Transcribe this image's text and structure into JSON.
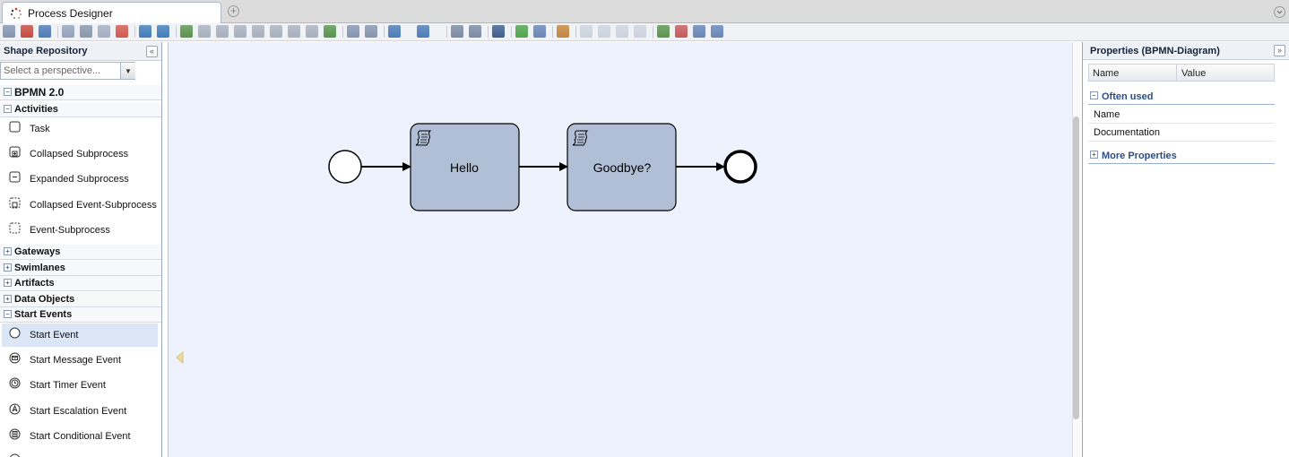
{
  "tab": {
    "title": "Process Designer"
  },
  "colors": {
    "accent": "#2b4d84",
    "task_fill": "#b0bfd6",
    "canvas_bg": "#eef2fc",
    "selected_item": "#dbe7f7"
  },
  "toolbar": {
    "icons": [
      "print-icon",
      "pdf-icon",
      "info-icon",
      "cut-icon",
      "copy-icon",
      "paste-icon",
      "delete-icon",
      "undo-icon",
      "redo-icon",
      "group-icon",
      "ungroup-icon",
      "align-left-icon",
      "align-center-icon",
      "align-right-icon",
      "align-top-icon",
      "align-middle-icon",
      "align-bottom-icon",
      "same-size-icon",
      "add-docker-icon",
      "remove-docker-icon",
      "import-icon",
      "export-icon",
      "zoom-in-icon",
      "zoom-out-icon",
      "save-icon",
      "validate-icon",
      "simulate-icon",
      "auto-layout-icon",
      "view-1-icon",
      "view-2-icon",
      "view-3-icon",
      "view-4-icon",
      "expand-icon",
      "collapse-icon",
      "fit-icon",
      "fullscreen-icon"
    ]
  },
  "repository": {
    "title": "Shape Repository",
    "perspective_placeholder": "Select a perspective...",
    "root": "BPMN 2.0",
    "groups": {
      "activities": {
        "label": "Activities",
        "items": [
          "Task",
          "Collapsed Subprocess",
          "Expanded Subprocess",
          "Collapsed Event-Subprocess",
          "Event-Subprocess"
        ]
      },
      "gateways": "Gateways",
      "swimlanes": "Swimlanes",
      "artifacts": "Artifacts",
      "data_objects": "Data Objects",
      "start_events": {
        "label": "Start Events",
        "items": [
          "Start Event",
          "Start Message Event",
          "Start Timer Event",
          "Start Escalation Event",
          "Start Conditional Event"
        ]
      }
    }
  },
  "diagram": {
    "tasks": [
      {
        "label": "Hello",
        "icon": "script-icon"
      },
      {
        "label": "Goodbye?",
        "icon": "script-icon"
      }
    ]
  },
  "properties": {
    "title": "Properties (BPMN-Diagram)",
    "columns": {
      "name": "Name",
      "value": "Value"
    },
    "sections": {
      "often_used": "Often used",
      "rows": [
        "Name",
        "Documentation"
      ],
      "more": "More Properties"
    }
  }
}
